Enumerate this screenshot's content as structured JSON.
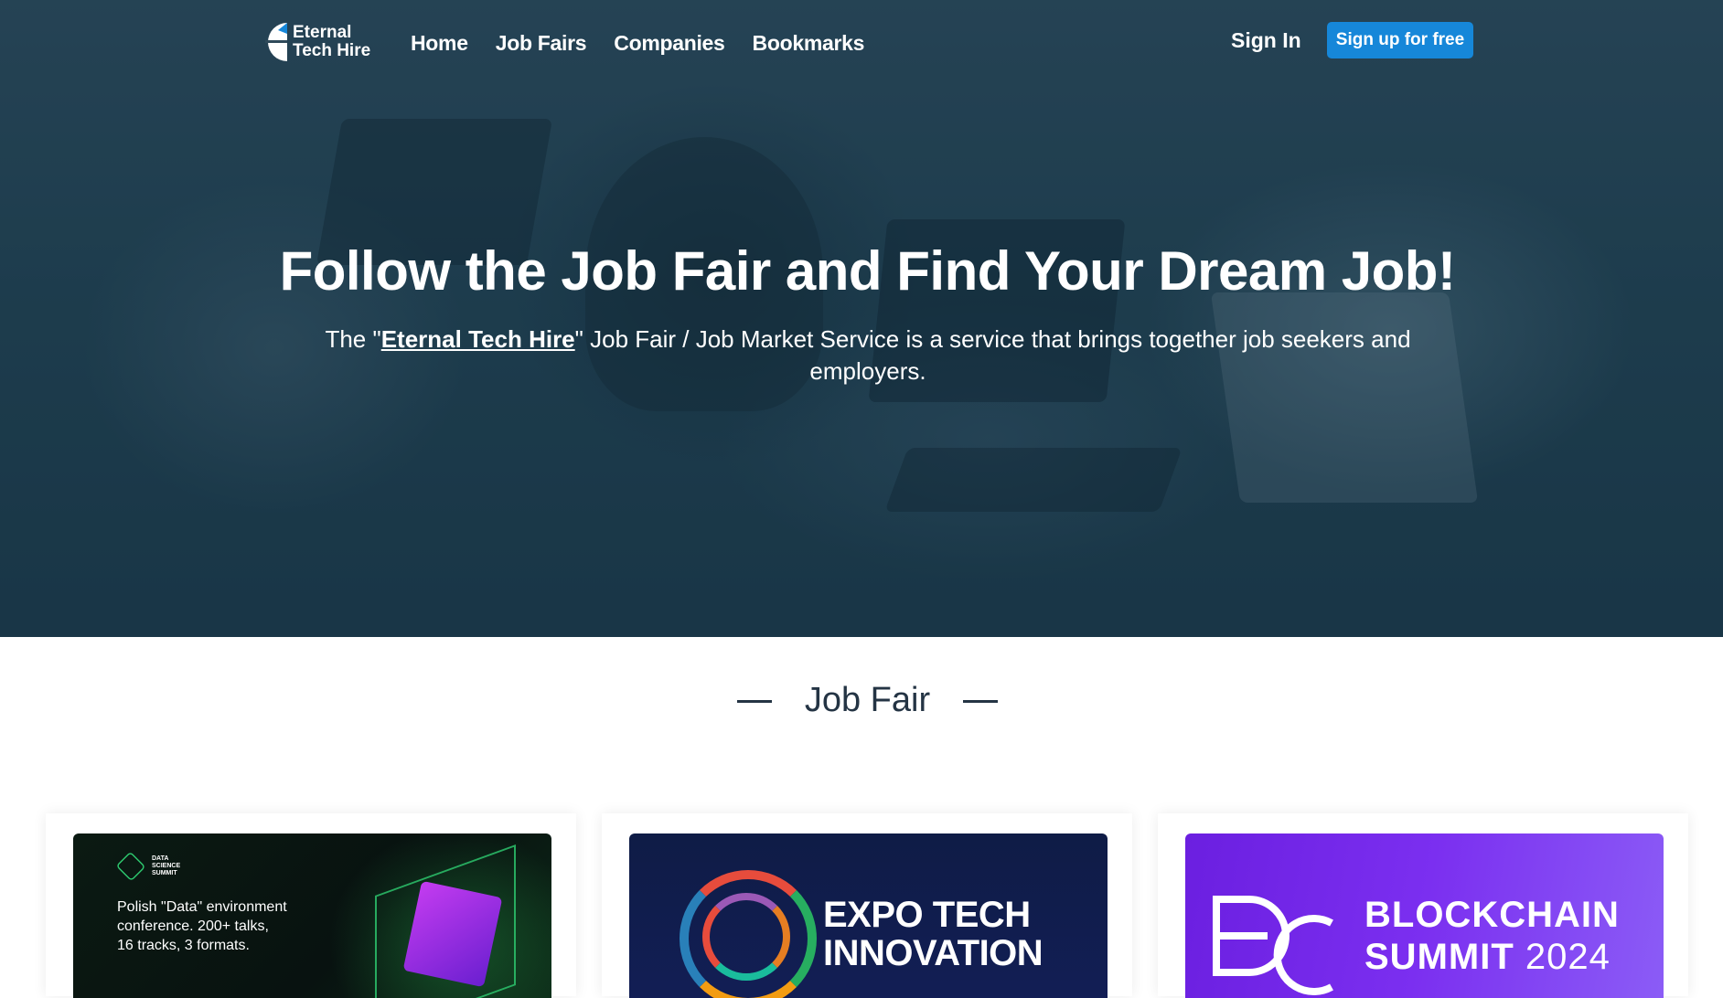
{
  "header": {
    "logo_line1": "Eternal",
    "logo_line2": "Tech Hire",
    "nav": [
      "Home",
      "Job Fairs",
      "Companies",
      "Bookmarks"
    ],
    "signin": "Sign In",
    "signup": "Sign up for free"
  },
  "hero": {
    "title": "Follow the Job Fair and Find Your Dream Job!",
    "sub_prefix": "The \"",
    "sub_link": "Eternal Tech Hire",
    "sub_suffix": "\" Job Fair / Job Market Service is a service that brings together job seekers and employers."
  },
  "section": {
    "title": "Job Fair"
  },
  "cards": [
    {
      "logo_text": "DATA SCIENCE SUMMIT",
      "text_lines": [
        "Polish \"Data\" environment",
        "conference. 200+ talks,",
        "16 tracks, 3 formats."
      ]
    },
    {
      "text_lines": [
        "EXPO TECH",
        "INNOVATION"
      ]
    },
    {
      "line1": "BLOCKCHAIN",
      "line2": "SUMMIT",
      "year": "2024"
    }
  ],
  "colors": {
    "accent": "#1687d9",
    "heading": "#243444"
  }
}
